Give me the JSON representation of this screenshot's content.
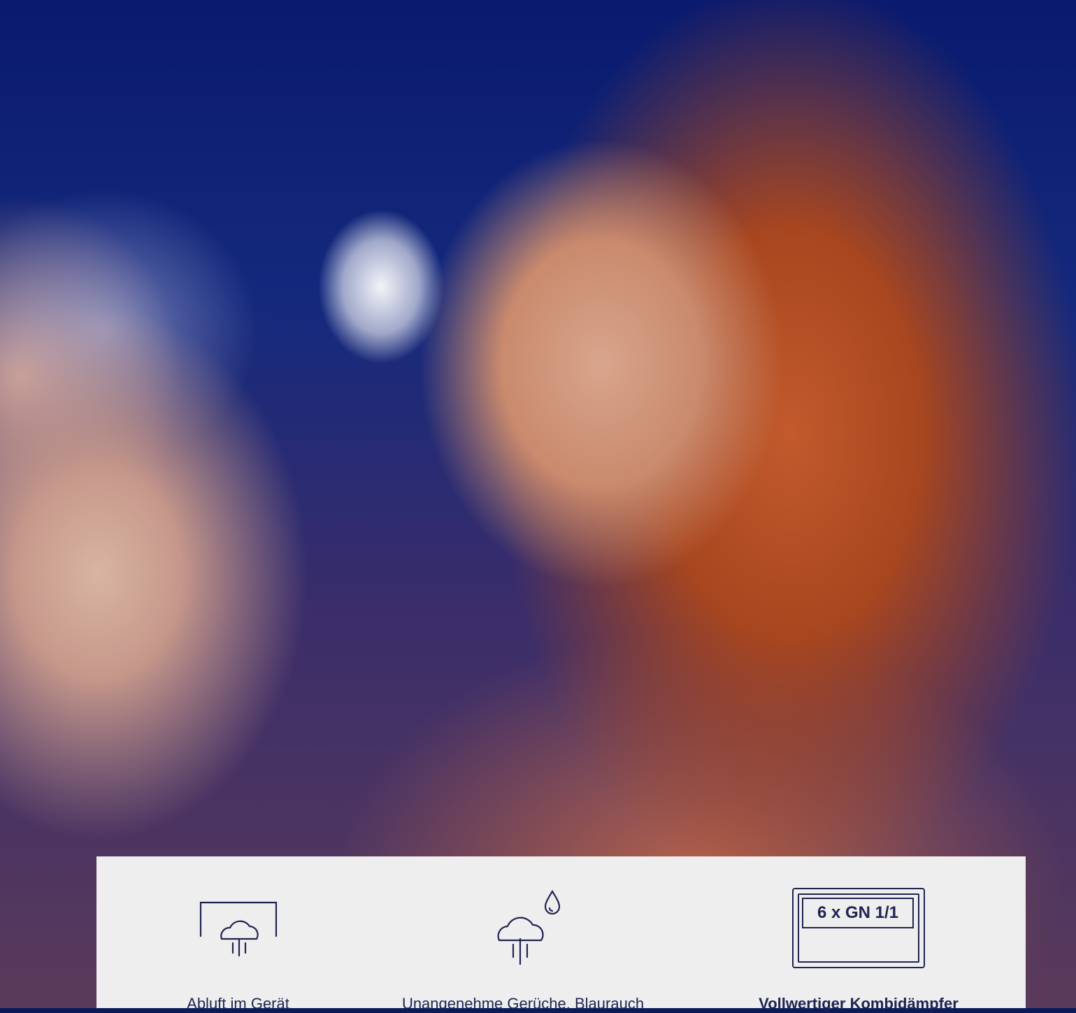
{
  "photo": {
    "subject": "woman with red hair smiling next to person eating a wrapped burger"
  },
  "features": [
    {
      "icon": "exhaust-hood-icon",
      "caption": "Abluft im Gerät"
    },
    {
      "icon": "steam-cloud-drop-icon",
      "caption": "Unangenehme Gerüche, Blaurauch"
    },
    {
      "icon": "gastronorm-tray-icon",
      "label": "6 x GN 1/1",
      "caption": "Vollwertiger Kombidämpfer"
    }
  ],
  "colors": {
    "panel_bg": "#efeeee",
    "ink": "#1e2452"
  }
}
